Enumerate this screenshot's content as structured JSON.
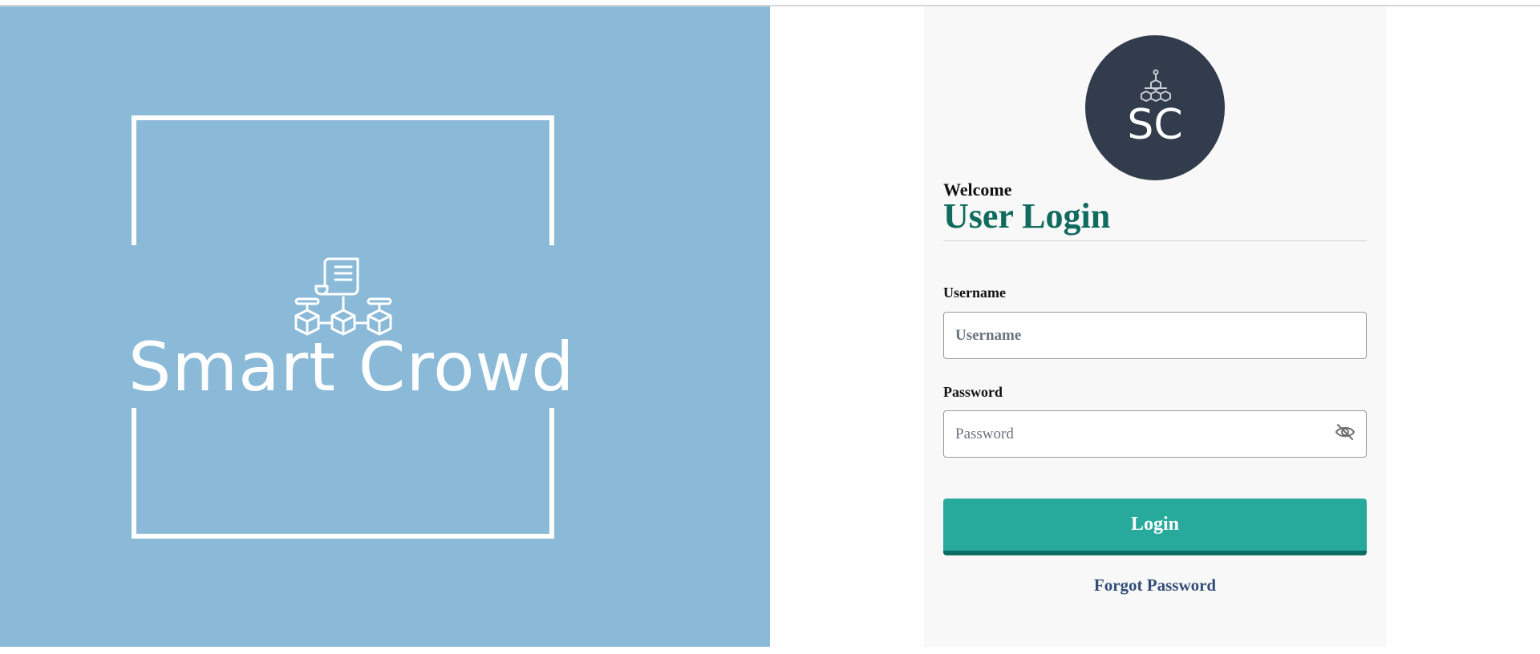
{
  "brand": {
    "name": "Smart Crowd",
    "logo_icon": "blockchain-contract-icon"
  },
  "login_card": {
    "avatar_initials": "SC",
    "avatar_icon": "blockchain-network-icon",
    "welcome": "Welcome",
    "heading": "User Login",
    "username": {
      "label": "Username",
      "placeholder": "Username",
      "value": ""
    },
    "password": {
      "label": "Password",
      "placeholder": "Password",
      "value": "",
      "toggle_icon": "eye-slash-icon"
    },
    "login_button": "Login",
    "forgot_password": "Forgot Password"
  },
  "colors": {
    "left_panel": "#8abad8",
    "heading": "#106b5e",
    "button": "#27aa9c",
    "link": "#324e78",
    "avatar": "#323c4d"
  }
}
